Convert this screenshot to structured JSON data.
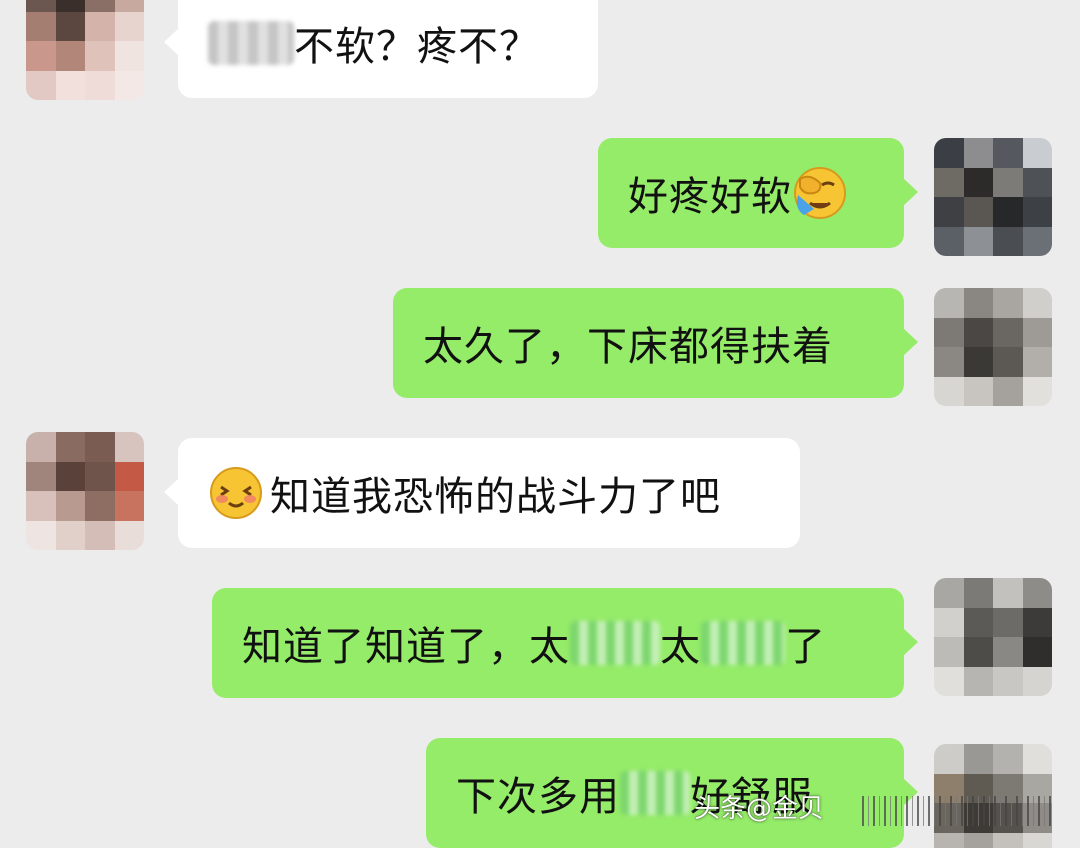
{
  "messages": [
    {
      "side": "in",
      "text_visible": "不软？疼不？"
    },
    {
      "side": "out",
      "text": "好疼好软",
      "emoji": "face-with-hand-crying-emoji"
    },
    {
      "side": "out",
      "text": "太久了，下床都得扶着"
    },
    {
      "side": "in",
      "emoji": "smiling-blushing-emoji",
      "text": "知道我恐怖的战斗力了吧"
    },
    {
      "side": "out",
      "parts": [
        "知道了知道了，太",
        "太",
        "了"
      ]
    },
    {
      "side": "out",
      "parts": [
        "下次多用",
        "好舒服"
      ]
    }
  ],
  "watermark": {
    "text": "头条@金贝"
  },
  "colors": {
    "background": "#ececec",
    "outgoing": "#95ec69",
    "incoming": "#ffffff"
  }
}
